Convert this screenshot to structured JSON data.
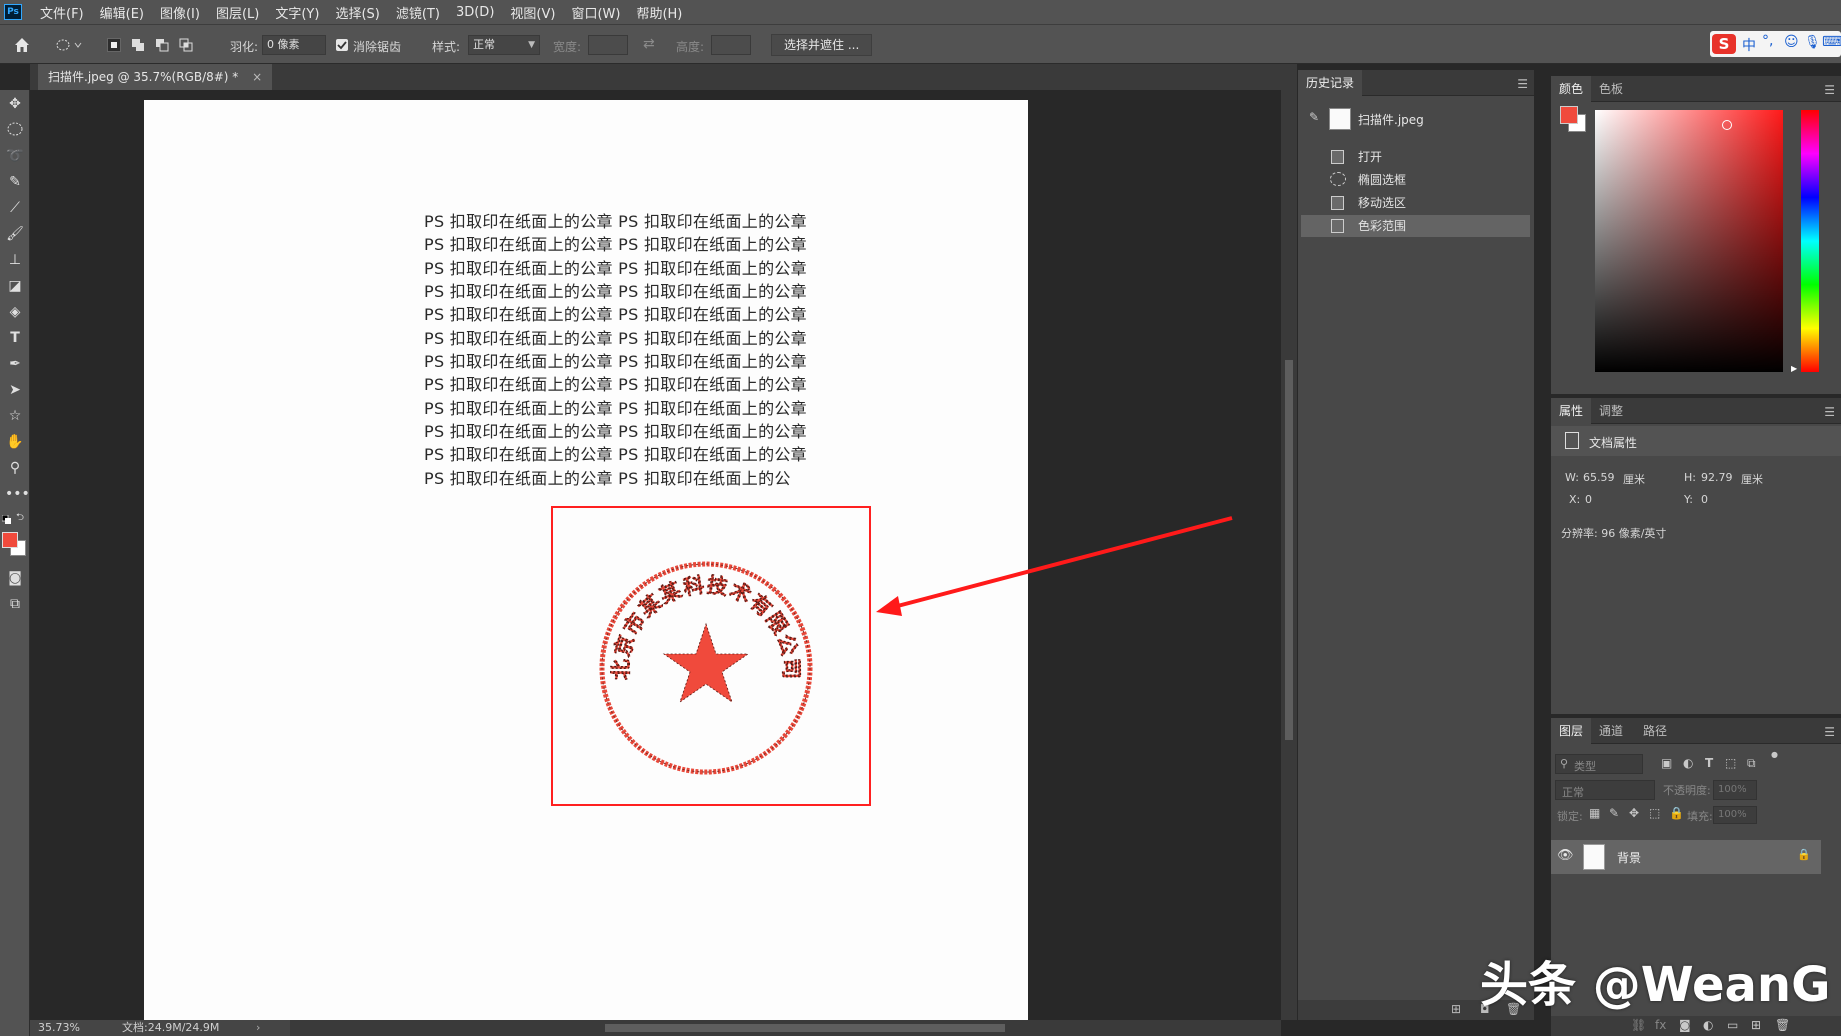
{
  "app": {
    "logo": "Ps"
  },
  "menu": [
    "文件(F)",
    "编辑(E)",
    "图像(I)",
    "图层(L)",
    "文字(Y)",
    "选择(S)",
    "滤镜(T)",
    "3D(D)",
    "视图(V)",
    "窗口(W)",
    "帮助(H)"
  ],
  "options": {
    "feather_label": "羽化:",
    "feather_value": "0 像素",
    "antialias_label": "消除锯齿",
    "style_label": "样式:",
    "style_value": "正常",
    "width_label": "宽度:",
    "height_label": "高度:",
    "select_mask_button": "选择并遮住 ..."
  },
  "ime": {
    "lang": "中"
  },
  "document": {
    "tab_title": "扫描件.jpeg @ 35.7%(RGB/8#) *",
    "text_lines": [
      "PS 扣取印在纸面上的公章 PS 扣取印在纸面上的公章",
      "PS 扣取印在纸面上的公章 PS 扣取印在纸面上的公章",
      "PS 扣取印在纸面上的公章 PS 扣取印在纸面上的公章",
      "PS 扣取印在纸面上的公章 PS 扣取印在纸面上的公章",
      "PS 扣取印在纸面上的公章 PS 扣取印在纸面上的公章",
      "PS 扣取印在纸面上的公章 PS 扣取印在纸面上的公章",
      "PS 扣取印在纸面上的公章 PS 扣取印在纸面上的公章",
      "PS 扣取印在纸面上的公章 PS 扣取印在纸面上的公章",
      "PS 扣取印在纸面上的公章 PS 扣取印在纸面上的公章",
      "PS 扣取印在纸面上的公章 PS 扣取印在纸面上的公章",
      "PS 扣取印在纸面上的公章 PS 扣取印在纸面上的公章",
      "PS 扣取印在纸面上的公章 PS 扣取印在纸面上的公"
    ],
    "seal_text": "北京市某某科技术有限公司"
  },
  "status": {
    "zoom": "35.73%",
    "doc_size": "文档:24.9M/24.9M"
  },
  "history": {
    "tab": "历史记录",
    "snapshot": "扫描件.jpeg",
    "items": [
      "打开",
      "椭圆选框",
      "移动选区",
      "色彩范围"
    ]
  },
  "color_panel": {
    "tabs": [
      "颜色",
      "色板"
    ],
    "foreground": "#f04a3c",
    "background": "#ffffff"
  },
  "properties": {
    "tabs": [
      "属性",
      "调整"
    ],
    "title": "文档属性",
    "w_label": "W:",
    "w_value": "65.59",
    "w_unit": "厘米",
    "h_label": "H:",
    "h_value": "92.79",
    "h_unit": "厘米",
    "x_label": "X:",
    "x_value": "0",
    "y_label": "Y:",
    "y_value": "0",
    "resolution": "分辨率: 96 像素/英寸"
  },
  "layers": {
    "tabs": [
      "图层",
      "通道",
      "路径"
    ],
    "filter_placeholder": "类型",
    "blend_mode": "正常",
    "opacity_label": "不透明度:",
    "opacity_value": "100%",
    "lock_label": "锁定:",
    "fill_label": "填充:",
    "fill_value": "100%",
    "items": [
      {
        "name": "背景"
      }
    ]
  },
  "watermark": "头条 @WeanG",
  "colors": {
    "accent_red": "#e8322a",
    "selection_red": "#ff2020"
  }
}
